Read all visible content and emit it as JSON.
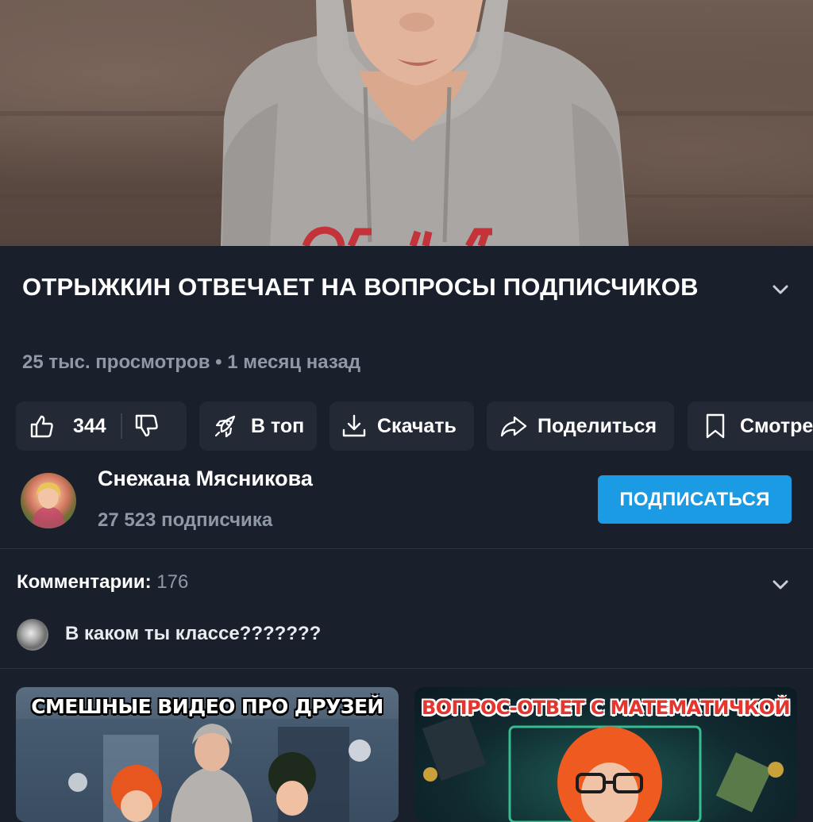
{
  "video": {
    "title": "ОТРЫЖКИН ОТВЕЧАЕТ НА ВОПРОСЫ ПОДПИСЧИКОВ",
    "meta": "25 тыс. просмотров • 1 месяц назад"
  },
  "actions": {
    "likes": "344",
    "top_label": "В топ",
    "download_label": "Скачать",
    "share_label": "Поделиться",
    "save_label": "Смотреть позже"
  },
  "channel": {
    "name": "Снежана Мясникова",
    "subscribers": "27 523 подписчика",
    "subscribe_label": "ПОДПИСАТЬСЯ"
  },
  "comments": {
    "label": "Комментарии:",
    "count": "176",
    "preview_text": "В каком ты классе???????"
  },
  "recommended": [
    {
      "caption": "СМЕШНЫЕ ВИДЕО ПРО ДРУЗЕЙ"
    },
    {
      "caption": "ВОПРОС-ОТВЕТ С МАТЕМАТИЧКОЙ"
    }
  ],
  "colors": {
    "background": "#19202b",
    "chip": "#232a35",
    "accent": "#1a9be4",
    "secondary_text": "#8e98a7"
  },
  "icons": [
    "thumbs-up-icon",
    "thumbs-down-icon",
    "rocket-icon",
    "download-icon",
    "share-arrow-icon",
    "bookmark-icon",
    "chevron-down-icon"
  ]
}
